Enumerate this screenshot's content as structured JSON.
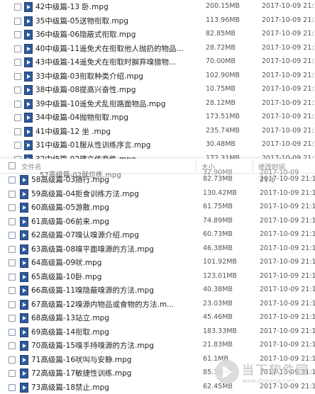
{
  "top_files": [
    {
      "name": "42中级篇-13 卧.mpg",
      "size": "200.15MB",
      "date": "2017-10-09 21:1"
    },
    {
      "name": "35中级篇-05送物衔取.mpg",
      "size": "113.96MB",
      "date": "2017-10-09 21:1"
    },
    {
      "name": "36中级篇-06隐蔽式衔取.mpg",
      "size": "82.85MB",
      "date": "2017-10-09 21:1"
    },
    {
      "name": "40中级篇-11遥免犬在衔取他人抛扔的物品...",
      "size": "28.72MB",
      "date": "2017-10-09 21:1"
    },
    {
      "name": "43中级篇-14遥免犬在衔取时摒弃嗅猎物...",
      "size": "70.00MB",
      "date": "2017-10-09 21:1"
    },
    {
      "name": "33中级篇-03衔取种类介绍.mpg",
      "size": "102.90MB",
      "date": "2017-10-09 21:1"
    },
    {
      "name": "38中级篇-08提高兴奋性.mpg",
      "size": "10.75MB",
      "date": "2017-10-09 21:1"
    },
    {
      "name": "39中级篇-10遥免犬乱衔路面物品.mpg",
      "size": "28.12MB",
      "date": "2017-10-09 21:1"
    },
    {
      "name": "34中级篇-04抛物衔取.mpg",
      "size": "173.51MB",
      "date": "2017-10-09 21:1"
    },
    {
      "name": "41中级篇-12 坐 .mpg",
      "size": "235.74MB",
      "date": "2017-10-09 21:1"
    },
    {
      "name": "31中级篇-01服从性训练序言.mpg",
      "size": "30.48MB",
      "date": "2017-10-09 21:1"
    },
    {
      "name": "32中级篇-02建立依恋性.mpg",
      "size": "172.31MB",
      "date": "2017-10-09 21:1"
    }
  ],
  "header": {
    "name_col": "文件名",
    "size_col": "大小",
    "date_col": "修改时间",
    "ghost_name": "57高级篇-02就位练.mpg",
    "ghost_size": "32.90MB",
    "ghost_date": "2017-10-09 21:1"
  },
  "bottom_files": [
    {
      "name": "58高级篇-03随行.mpg",
      "size": "82.73MB",
      "date": "2017-10-09 21:1"
    },
    {
      "name": "59高级篇-04拒食训练方法.mpg",
      "size": "130.42MB",
      "date": "2017-10-09 21:1"
    },
    {
      "name": "60高级篇-05游散.mpg",
      "size": "61.75MB",
      "date": "2017-10-09 21:1"
    },
    {
      "name": "61高级篇-06前来.mpg",
      "size": "74.89MB",
      "date": "2017-10-09 21:1"
    },
    {
      "name": "62高级篇-07嗅认嗅源介绍.mpg",
      "size": "60.73MB",
      "date": "2017-10-09 21:1"
    },
    {
      "name": "63高级篇-08嗅平面嗅源的方法.mpg",
      "size": "46.38MB",
      "date": "2017-10-09 21:1"
    },
    {
      "name": "64高级篇-09吠.mpg",
      "size": "101.92MB",
      "date": "2017-10-09 21:1"
    },
    {
      "name": "65高级篇-10卧.mpg",
      "size": "123.01MB",
      "date": "2017-10-09 21:1"
    },
    {
      "name": "66高级篇-11嗅隐蔽嗅源的方法.mpg",
      "size": "40.38MB",
      "date": "2017-10-09 21:1"
    },
    {
      "name": "67高级篇-12嗅源内物品或食物的方法.m...",
      "size": "23.03MB",
      "date": "2017-10-09 21:1"
    },
    {
      "name": "68高级篇-13站立.mpg",
      "size": "45.46MB",
      "date": "2017-10-09 21:1"
    },
    {
      "name": "69高级篇-14衔取.mpg",
      "size": "183.33MB",
      "date": "2017-10-09 21:1"
    },
    {
      "name": "70高级篇-15嗅手持嗅源的方法.mpg",
      "size": "21.83MB",
      "date": "2017-10-09 21:1"
    },
    {
      "name": "71高级篇-16吠叫与安静.mpg",
      "size": "61.1MB",
      "date": "2017-10-09 21:1"
    },
    {
      "name": "72高级篇-17敏捷性训练.mpg",
      "size": "85.15MB",
      "date": "2017-10-09 21:1"
    },
    {
      "name": "73高级篇-18禁止.mpg",
      "size": "62.45MB",
      "date": "2017-10-09 21:1"
    }
  ],
  "watermark": {
    "title": "当下软件园",
    "subtitle": "www.downxia.com"
  }
}
